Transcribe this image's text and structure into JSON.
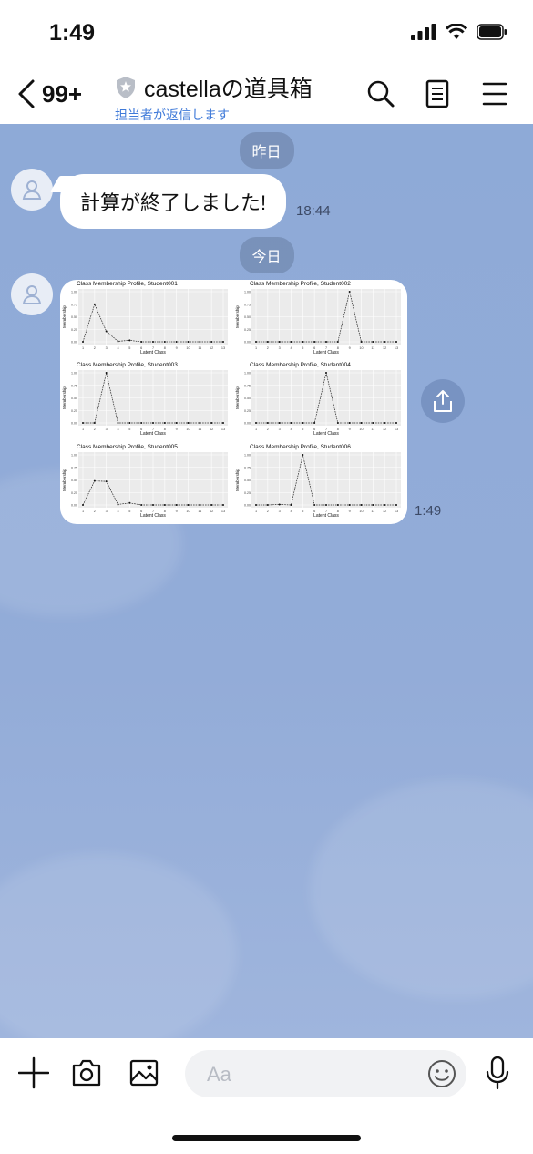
{
  "status": {
    "time": "1:49"
  },
  "header": {
    "back_count": "99+",
    "title": "castellaの道具箱",
    "subtitle": "担当者が返信します"
  },
  "chat": {
    "date1": "昨日",
    "msg1": {
      "text": "計算が終了しました!",
      "time": "18:44"
    },
    "date2": "今日",
    "msg2": {
      "time": "1:49"
    }
  },
  "chart_data": [
    {
      "type": "line",
      "title": "Class Membership Profile, Student001",
      "xlabel": "Latent Class",
      "ylabel": "Membership",
      "x": [
        1,
        2,
        3,
        4,
        5,
        6,
        7,
        8,
        9,
        10,
        11,
        12,
        13
      ],
      "y": [
        0,
        0.75,
        0.21,
        0.01,
        0.03,
        0,
        0,
        0,
        0,
        0,
        0,
        0,
        0
      ],
      "ylim": [
        0,
        1
      ],
      "yticks": [
        "0.00",
        "0.25",
        "0.50",
        "0.75",
        "1.00"
      ]
    },
    {
      "type": "line",
      "title": "Class Membership Profile, Student002",
      "xlabel": "Latent Class",
      "ylabel": "Membership",
      "x": [
        1,
        2,
        3,
        4,
        5,
        6,
        7,
        8,
        9,
        10,
        11,
        12,
        13
      ],
      "y": [
        0,
        0,
        0,
        0,
        0,
        0,
        0,
        0,
        1,
        0,
        0,
        0,
        0
      ],
      "ylim": [
        0,
        1
      ],
      "yticks": [
        "0.00",
        "0.25",
        "0.50",
        "0.75",
        "1.00"
      ]
    },
    {
      "type": "line",
      "title": "Class Membership Profile, Student003",
      "xlabel": "Latent Class",
      "ylabel": "Membership",
      "x": [
        1,
        2,
        3,
        4,
        5,
        6,
        7,
        8,
        9,
        10,
        11,
        12,
        13
      ],
      "y": [
        0,
        0,
        1,
        0,
        0,
        0,
        0,
        0,
        0,
        0,
        0,
        0,
        0
      ],
      "ylim": [
        0,
        1
      ],
      "yticks": [
        "0.00",
        "0.25",
        "0.50",
        "0.75",
        "1.00"
      ]
    },
    {
      "type": "line",
      "title": "Class Membership Profile, Student004",
      "xlabel": "Latent Class",
      "ylabel": "Membership",
      "x": [
        1,
        2,
        3,
        4,
        5,
        6,
        7,
        8,
        9,
        10,
        11,
        12,
        13
      ],
      "y": [
        0,
        0,
        0,
        0,
        0,
        0,
        1,
        0,
        0,
        0,
        0,
        0,
        0
      ],
      "ylim": [
        0,
        1
      ],
      "yticks": [
        "0.00",
        "0.25",
        "0.50",
        "0.75",
        "1.00"
      ]
    },
    {
      "type": "line",
      "title": "Class Membership Profile, Student005",
      "xlabel": "Latent Class",
      "ylabel": "Membership",
      "x": [
        1,
        2,
        3,
        4,
        5,
        6,
        7,
        8,
        9,
        10,
        11,
        12,
        13
      ],
      "y": [
        0,
        0.48,
        0.47,
        0.01,
        0.04,
        0,
        0,
        0,
        0,
        0,
        0,
        0,
        0
      ],
      "ylim": [
        0,
        1
      ],
      "yticks": [
        "0.00",
        "0.25",
        "0.50",
        "0.75",
        "1.00"
      ]
    },
    {
      "type": "line",
      "title": "Class Membership Profile, Student006",
      "xlabel": "Latent Class",
      "ylabel": "Membership",
      "x": [
        1,
        2,
        3,
        4,
        5,
        6,
        7,
        8,
        9,
        10,
        11,
        12,
        13
      ],
      "y": [
        0,
        0,
        0.01,
        0,
        1,
        0,
        0,
        0,
        0,
        0,
        0,
        0,
        0
      ],
      "ylim": [
        0,
        1
      ],
      "yticks": [
        "0.00",
        "0.25",
        "0.50",
        "0.75",
        "1.00"
      ]
    }
  ],
  "input": {
    "placeholder": "Aa"
  },
  "icons": {
    "back": "chevron-left-icon",
    "search": "search-icon",
    "notes": "notes-icon",
    "menu": "menu-icon",
    "plus": "plus-icon",
    "camera": "camera-icon",
    "image": "image-icon",
    "emoji": "emoji-icon",
    "mic": "mic-icon",
    "share": "share-icon",
    "verified": "shield-icon"
  },
  "colors": {
    "chat_bg": "#8eaad7",
    "subtitle": "#3f7ad9",
    "accent": "#7893c2"
  }
}
